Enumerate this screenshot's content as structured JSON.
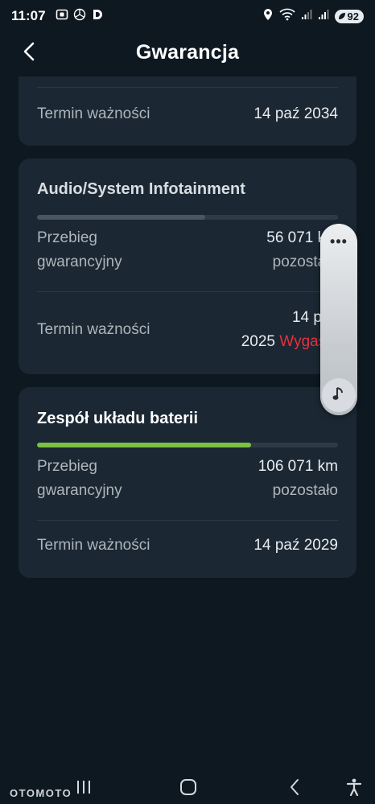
{
  "status_bar": {
    "time": "11:07",
    "battery": "92"
  },
  "header": {
    "title": "Gwarancja"
  },
  "cards": [
    {
      "expiry_label": "Termin ważności",
      "expiry_value": "14 paź 2034"
    },
    {
      "title": "Audio/System Infotainment",
      "progress_percent": 56,
      "progress_color": "#4a565f",
      "mileage_label_line1": "Przebieg",
      "mileage_label_line2": "gwarancyjny",
      "mileage_value_line1": "56 071 km",
      "mileage_value_line2": "pozostało",
      "expiry_label": "Termin ważności",
      "expiry_value_line1": "14 paź",
      "expiry_value_year": "2025",
      "expiry_status": "Wygasło",
      "expiry_status_color": "#e8303f"
    },
    {
      "title": "Zespół układu baterii",
      "progress_percent": 71,
      "progress_color": "#7cc242",
      "mileage_label_line1": "Przebieg",
      "mileage_label_line2": "gwarancyjny",
      "mileage_value_line1": "106 071 km",
      "mileage_value_line2": "pozostało",
      "expiry_label": "Termin ważności",
      "expiry_value": "14 paź 2029"
    }
  ],
  "volume_panel": {
    "menu_icon": "more-dots-icon",
    "knob_icon": "music-note-icon"
  },
  "nav_bar": {
    "watermark": "OTOMOTO"
  }
}
